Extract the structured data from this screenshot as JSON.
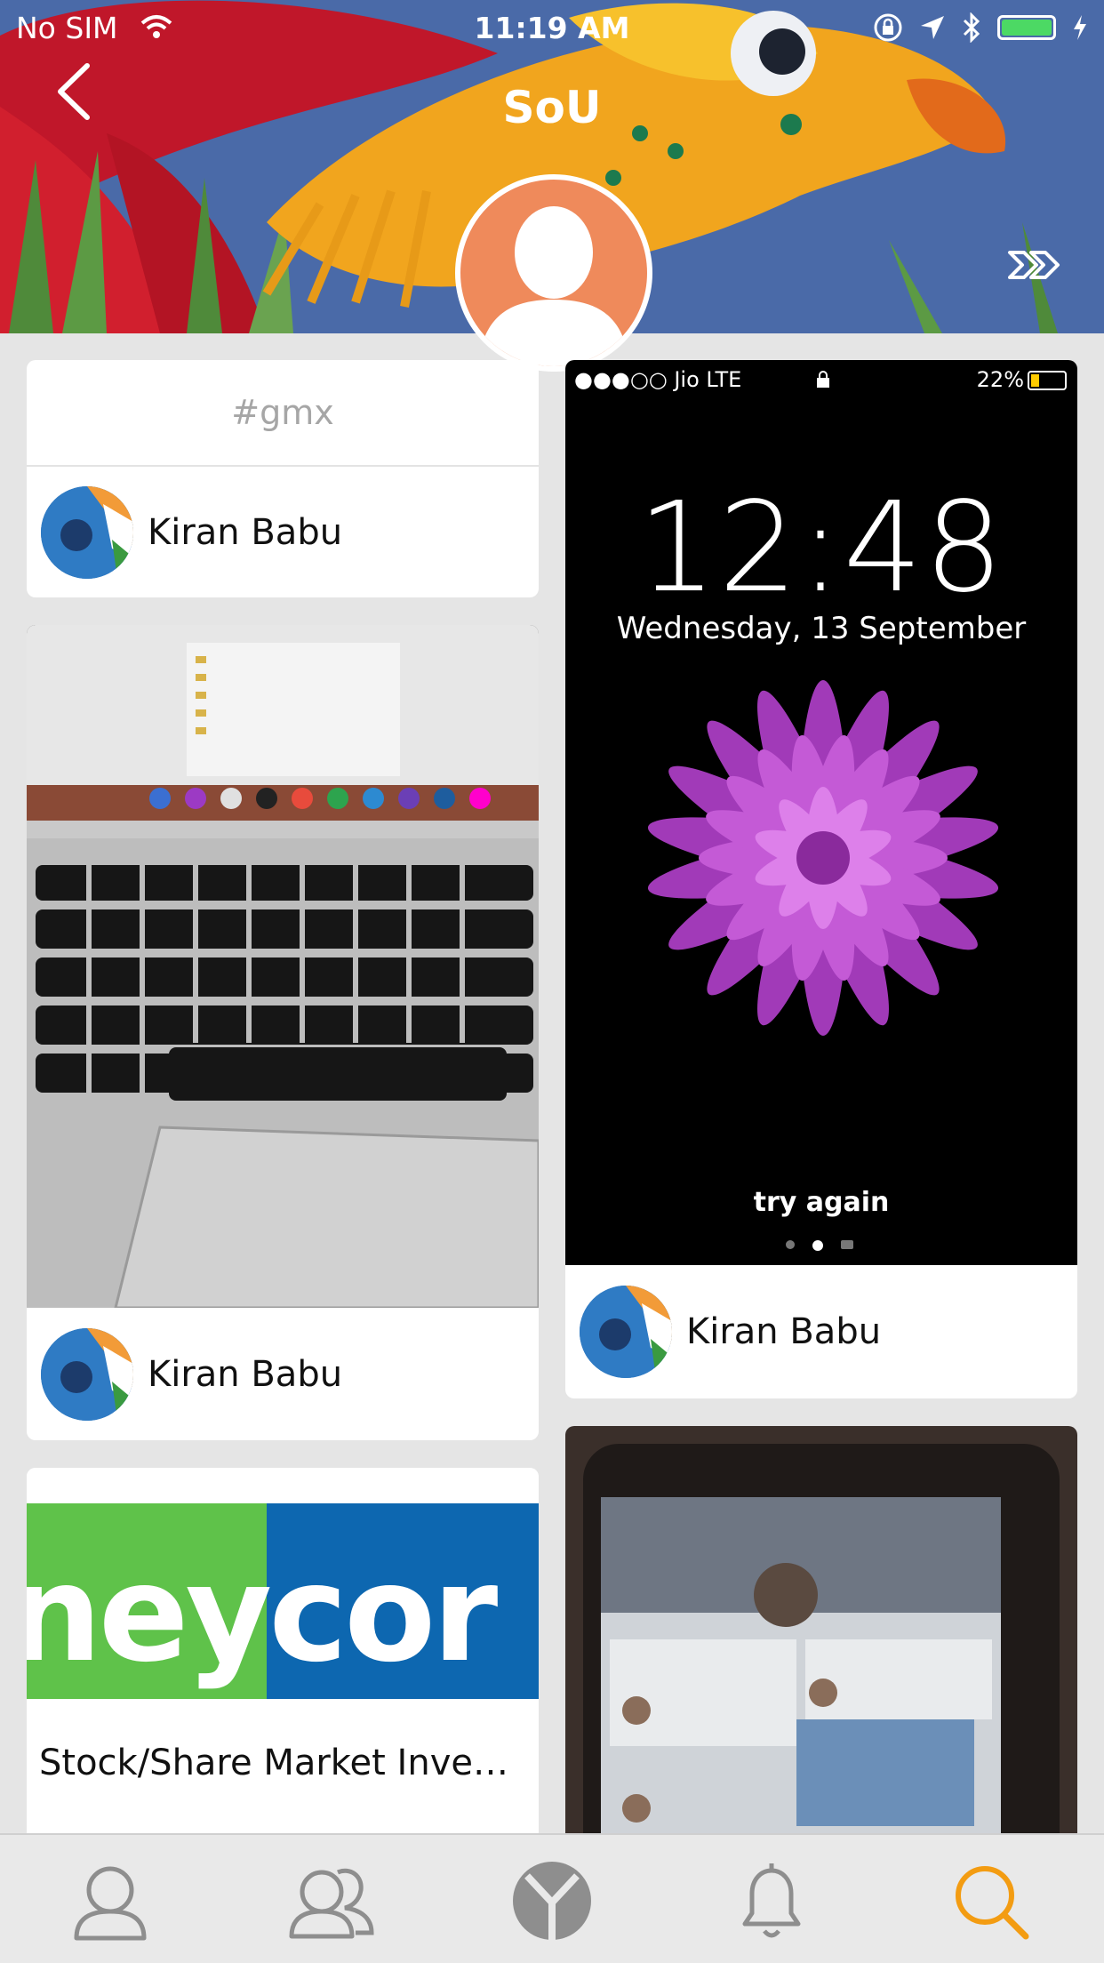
{
  "status_bar": {
    "carrier": "No SIM",
    "time": "11:19 AM"
  },
  "nav": {
    "title": "SoU"
  },
  "cards": {
    "hashtag_card": {
      "hashtag": "#gmx",
      "author": "Kiran Babu"
    },
    "laptop_card": {
      "author": "Kiran Babu"
    },
    "lockscreen_card": {
      "author": "Kiran Babu",
      "screen": {
        "carrier": "●●●○○ Jio  LTE",
        "battery": "22%",
        "time": "12:48",
        "date": "Wednesday, 13 September",
        "message": "try again"
      }
    },
    "article_card": {
      "logo_text": "neycor",
      "title": "Stock/Share Market Investi…"
    }
  },
  "tabs": [
    {
      "name": "profile",
      "active": false
    },
    {
      "name": "friends",
      "active": false
    },
    {
      "name": "home",
      "active": false
    },
    {
      "name": "notifications",
      "active": false
    },
    {
      "name": "search",
      "active": true
    }
  ],
  "colors": {
    "accent": "#f39c12",
    "avatar": "#ef8a5b",
    "tab_inactive": "#8e8e8e"
  }
}
